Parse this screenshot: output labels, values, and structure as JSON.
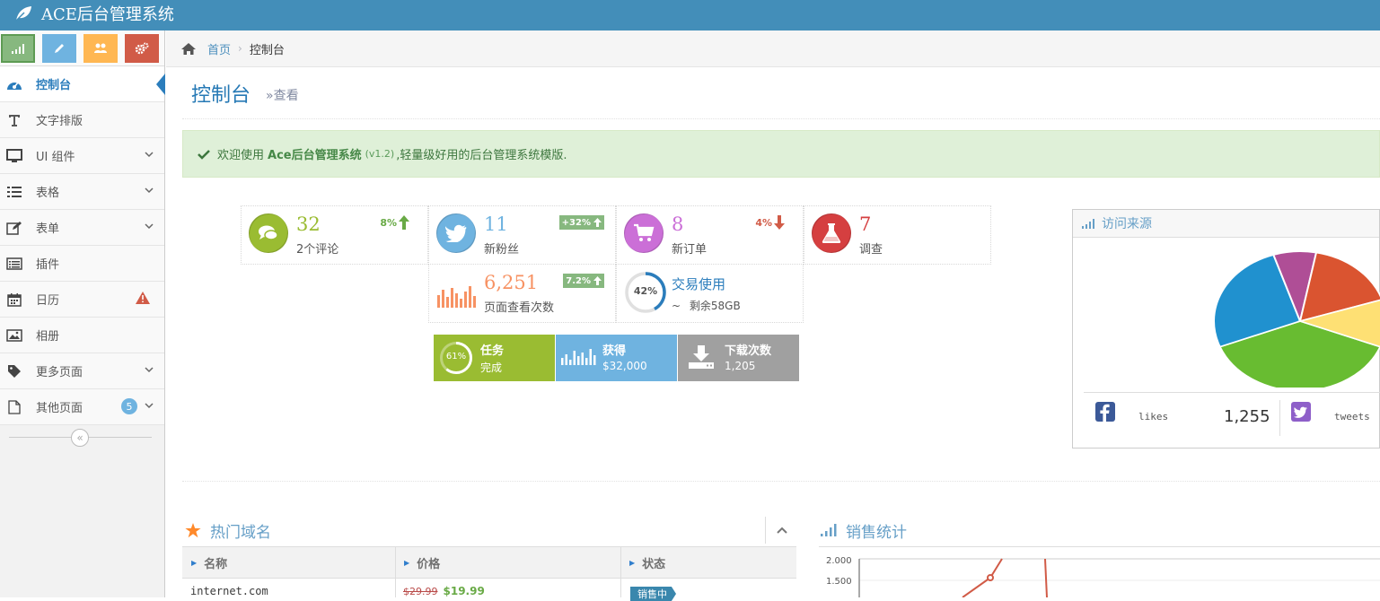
{
  "app": {
    "title": "ACE后台管理系统"
  },
  "breadcrumb": {
    "home": "首页",
    "current": "控制台"
  },
  "page": {
    "title": "控制台",
    "subtitle": "查看"
  },
  "sidebar": {
    "items": [
      {
        "label": "控制台",
        "icon": "dashboard-icon"
      },
      {
        "label": "文字排版",
        "icon": "text-icon"
      },
      {
        "label": "UI 组件",
        "icon": "desktop-icon"
      },
      {
        "label": "表格",
        "icon": "list-icon"
      },
      {
        "label": "表单",
        "icon": "edit-icon"
      },
      {
        "label": "插件",
        "icon": "list-alt-icon"
      },
      {
        "label": "日历",
        "icon": "calendar-icon"
      },
      {
        "label": "相册",
        "icon": "picture-icon"
      },
      {
        "label": "更多页面",
        "icon": "tag-icon"
      },
      {
        "label": "其他页面",
        "icon": "file-icon",
        "badge": "5"
      }
    ]
  },
  "alert": {
    "prefix": "欢迎使用",
    "brand": "Ace后台管理系统",
    "version": "(v1.2)",
    "suffix": ",轻量级好用的后台管理系统模版."
  },
  "infoboxes": {
    "comments": {
      "value": "32",
      "label": "2个评论",
      "stat": "8%"
    },
    "followers": {
      "value": "11",
      "label": "新粉丝",
      "stat": "+32%"
    },
    "orders": {
      "value": "8",
      "label": "新订单",
      "stat": "4%"
    },
    "survey": {
      "value": "7",
      "label": "调查"
    },
    "pageviews": {
      "value": "6,251",
      "label": "页面查看次数",
      "stat": "7.2%"
    },
    "transactions": {
      "value": "交易使用",
      "label": "剩余58GB",
      "prefix": "~",
      "percent": "42%",
      "progress": 0.42
    }
  },
  "smallboxes": {
    "tasks": {
      "title": "任务",
      "sub": "完成",
      "percent": "61%",
      "progress": 0.61
    },
    "earnings": {
      "title": "获得",
      "sub": "$32,000"
    },
    "downloads": {
      "title": "下载次数",
      "sub": "1,205"
    }
  },
  "visits": {
    "title": "访问来源",
    "facebook": {
      "text": "likes",
      "value": "1,255"
    },
    "twitter": {
      "text": "tweets"
    },
    "colors": [
      "#68bc31",
      "#2091cf",
      "#af4e96",
      "#da5430",
      "#fee074"
    ]
  },
  "domains": {
    "title": "热门域名",
    "columns": [
      "名称",
      "价格",
      "状态"
    ],
    "rows": [
      {
        "name": "internet.com",
        "old_price": "$29.99",
        "price": "$19.99",
        "status": "销售中"
      }
    ]
  },
  "sales": {
    "title": "销售统计",
    "ticks": [
      "2.000",
      "1.500"
    ]
  }
}
